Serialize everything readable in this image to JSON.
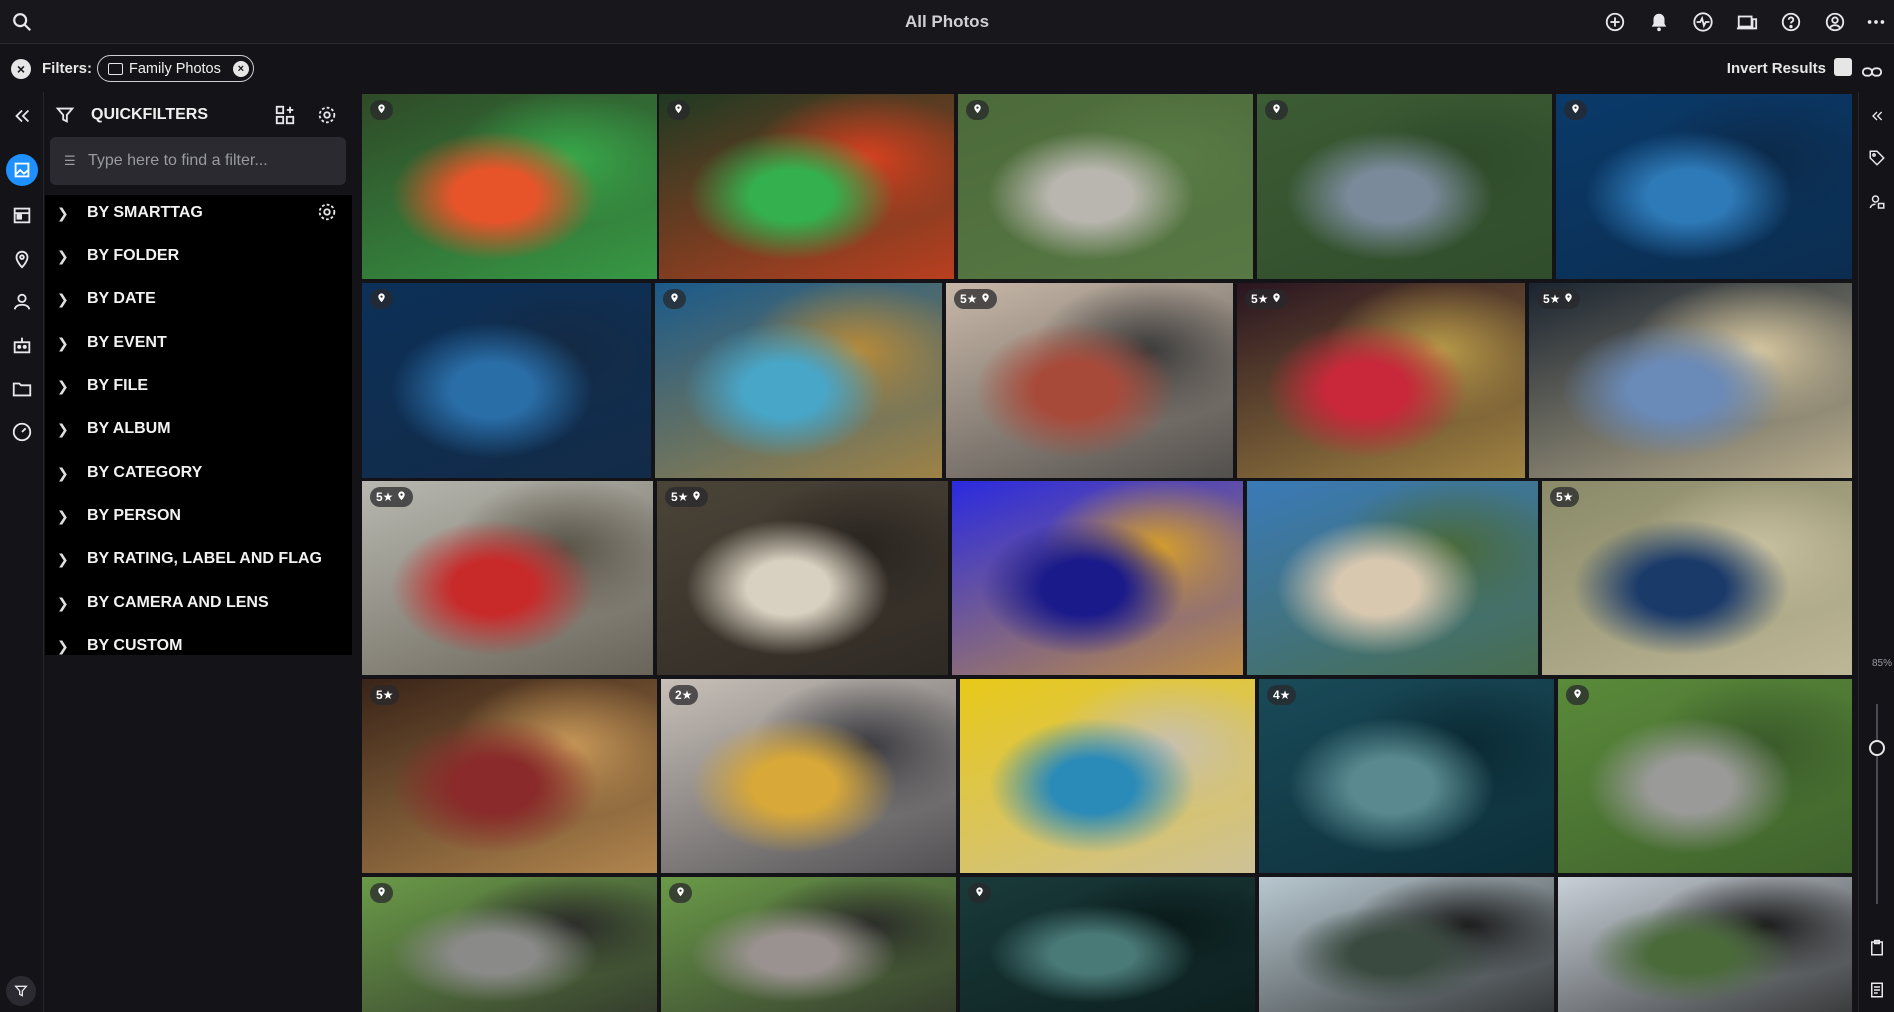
{
  "app": {
    "title": "All Photos"
  },
  "topbar": {
    "icons": [
      "search-icon",
      "add-icon",
      "bell-icon",
      "activity-icon",
      "devices-icon",
      "help-icon",
      "account-icon",
      "more-icon"
    ]
  },
  "filterbar": {
    "label": "Filters:",
    "chip": {
      "text": "Family Photos",
      "icon": "folder-icon"
    },
    "invert_label": "Invert Results"
  },
  "panel": {
    "title": "QUICKFILTERS",
    "search_placeholder": "Type here to find a filter...",
    "items": [
      {
        "label": "BY SMARTTAG"
      },
      {
        "label": "BY FOLDER"
      },
      {
        "label": "BY DATE"
      },
      {
        "label": "BY EVENT"
      },
      {
        "label": "BY FILE"
      },
      {
        "label": "BY ALBUM"
      },
      {
        "label": "BY CATEGORY"
      },
      {
        "label": "BY PERSON"
      },
      {
        "label": "BY RATING, LABEL AND FLAG"
      },
      {
        "label": "BY CAMERA AND LENS"
      },
      {
        "label": "BY CUSTOM"
      }
    ]
  },
  "zoom": {
    "label": "85%"
  },
  "photos": [
    {
      "badge": "",
      "pin": true,
      "subject": "parrot-on-hand",
      "colors": [
        "#2f4a28",
        "#e8542a",
        "#38a84a"
      ]
    },
    {
      "badge": "",
      "pin": true,
      "subject": "parrot-on-hand-2",
      "colors": [
        "#1f3a22",
        "#34b04e",
        "#d84020"
      ]
    },
    {
      "badge": "",
      "pin": true,
      "subject": "woman-with-parrots",
      "colors": [
        "#4c6a3a",
        "#b8b6ae",
        "#5a7c46"
      ]
    },
    {
      "badge": "",
      "pin": true,
      "subject": "man-with-parrots",
      "colors": [
        "#3c5c34",
        "#7a8a9a",
        "#2e4a2a"
      ]
    },
    {
      "badge": "",
      "pin": true,
      "subject": "aquarium-tunnel",
      "colors": [
        "#0a3a6a",
        "#2e7ab8",
        "#0c2a4a"
      ]
    },
    {
      "badge": "",
      "pin": true,
      "subject": "family-at-aquarium",
      "colors": [
        "#0c3058",
        "#2a6ea8",
        "#142a44"
      ]
    },
    {
      "badge": "",
      "pin": true,
      "subject": "child-at-fish-tank",
      "colors": [
        "#1a5a8a",
        "#48a6c8",
        "#b88a38"
      ]
    },
    {
      "badge": "5★",
      "pin": true,
      "subject": "photographer-goldfish-bags",
      "colors": [
        "#c8b8a8",
        "#a84a3a",
        "#3a3a3a"
      ]
    },
    {
      "badge": "5★",
      "pin": true,
      "subject": "night-market-backpacker",
      "colors": [
        "#2a1420",
        "#c8283a",
        "#b89a48"
      ]
    },
    {
      "badge": "5★",
      "pin": true,
      "subject": "man-eating-street-food",
      "colors": [
        "#1a2430",
        "#6a8ab8",
        "#d8c8a0"
      ]
    },
    {
      "badge": "5★",
      "pin": true,
      "subject": "traveler-lantern-street",
      "colors": [
        "#b8b8b0",
        "#c82a2a",
        "#5a5448"
      ]
    },
    {
      "badge": "5★",
      "pin": true,
      "subject": "man-eating-bowl",
      "colors": [
        "#4a4438",
        "#d8d0c0",
        "#2a2420"
      ]
    },
    {
      "badge": "",
      "pin": false,
      "subject": "jellyfish-silhouettes",
      "colors": [
        "#2a2ae0",
        "#1a1a8a",
        "#d8a028"
      ]
    },
    {
      "badge": "",
      "pin": false,
      "subject": "phone-photo-horse",
      "colors": [
        "#3a7ab8",
        "#d8c8b0",
        "#4a6a3a"
      ]
    },
    {
      "badge": "5★",
      "pin": false,
      "subject": "hiker-smiling-forest",
      "colors": [
        "#8a8a68",
        "#1a3a6a",
        "#c8c0a0"
      ]
    },
    {
      "badge": "5★",
      "pin": false,
      "subject": "bearded-man-cafe",
      "colors": [
        "#3a2418",
        "#8a2a2a",
        "#c89858"
      ]
    },
    {
      "badge": "2★",
      "pin": false,
      "subject": "family-on-couch",
      "colors": [
        "#c8c0b8",
        "#d8a838",
        "#3a3a40"
      ]
    },
    {
      "badge": "",
      "pin": false,
      "subject": "woman-yellow-wall",
      "colors": [
        "#e8c818",
        "#2a8ab8",
        "#c8c0b0"
      ]
    },
    {
      "badge": "4★",
      "pin": false,
      "subject": "shark-aquarium",
      "colors": [
        "#1a4a58",
        "#5a8a90",
        "#0a2a34"
      ]
    },
    {
      "badge": "",
      "pin": true,
      "subject": "hiker-with-horse",
      "colors": [
        "#5a8a3a",
        "#9a9a98",
        "#3a5a2a"
      ]
    },
    {
      "badge": "",
      "pin": true,
      "subject": "hiker-feeding-horse",
      "colors": [
        "#6a9a48",
        "#8a8a88",
        "#2a2a28"
      ]
    },
    {
      "badge": "",
      "pin": true,
      "subject": "hiker-feeding-horse-2",
      "colors": [
        "#6a9a48",
        "#9a9290",
        "#2a2a28"
      ]
    },
    {
      "badge": "",
      "pin": true,
      "subject": "photographing-fish",
      "colors": [
        "#1a3a3a",
        "#4a7a78",
        "#0a1a1a"
      ]
    },
    {
      "badge": "",
      "pin": false,
      "subject": "telephoto-lens-lake",
      "colors": [
        "#b8c8d0",
        "#3a4a40",
        "#1a1a1a"
      ]
    },
    {
      "badge": "",
      "pin": false,
      "subject": "telephoto-lens-reeds",
      "colors": [
        "#c8d0d8",
        "#4a6a3a",
        "#1a1a1a"
      ]
    }
  ]
}
